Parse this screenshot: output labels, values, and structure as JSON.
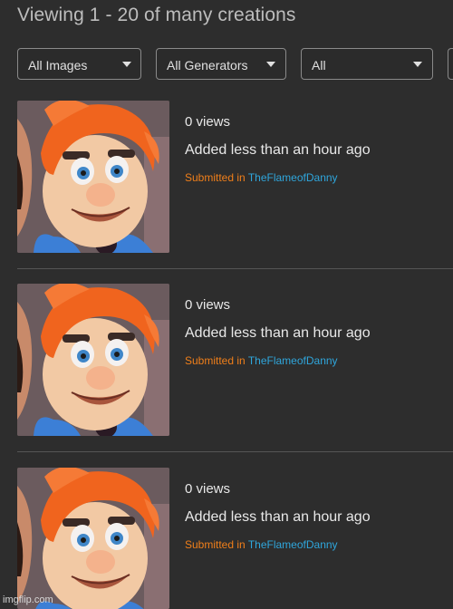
{
  "header": {
    "title": "Viewing 1 - 20 of many creations"
  },
  "filters": {
    "type": {
      "selected": "All Images"
    },
    "generator": {
      "selected": "All Generators"
    },
    "time": {
      "selected": "All"
    }
  },
  "items": [
    {
      "views": "0 views",
      "added": "Added less than an hour ago",
      "submitted_prefix": "Submitted in",
      "stream": "TheFlameofDanny"
    },
    {
      "views": "0 views",
      "added": "Added less than an hour ago",
      "submitted_prefix": "Submitted in",
      "stream": "TheFlameofDanny"
    },
    {
      "views": "0 views",
      "added": "Added less than an hour ago",
      "submitted_prefix": "Submitted in",
      "stream": "TheFlameofDanny"
    }
  ],
  "watermark": "imgflip.com",
  "colors": {
    "submitted_prefix": "#f07f1a",
    "stream_link": "#2fa6dc",
    "background": "#2d2d2d"
  }
}
